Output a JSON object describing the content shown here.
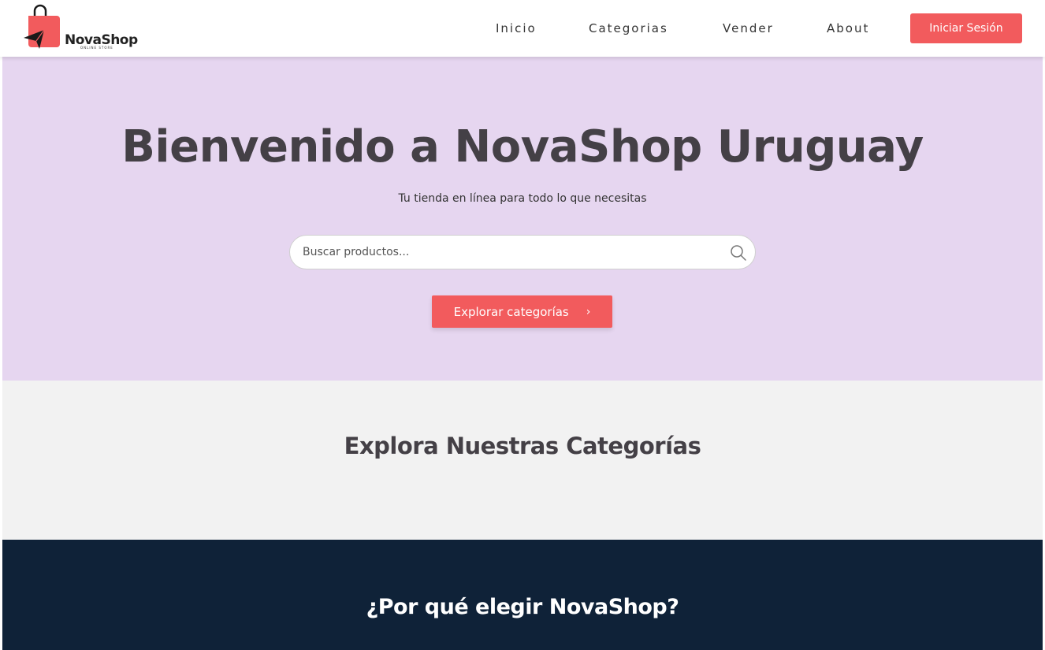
{
  "header": {
    "logo": {
      "name": "NovaShop",
      "tagline": "ONLINE STORE"
    },
    "nav": [
      {
        "label": "Inicio"
      },
      {
        "label": "Categorias"
      },
      {
        "label": "Vender"
      },
      {
        "label": "About"
      }
    ],
    "login_label": "Iniciar Sesión"
  },
  "hero": {
    "title": "Bienvenido a NovaShop Uruguay",
    "subtitle": "Tu tienda en línea para todo lo que necesitas",
    "search": {
      "placeholder": "Buscar productos...",
      "value": "",
      "icon": "search-icon"
    },
    "explore_label": "Explorar categorías",
    "explore_icon": "chevron-right-icon"
  },
  "categories": {
    "title": "Explora Nuestras Categorías"
  },
  "why": {
    "title": "¿Por qué elegir NovaShop?"
  },
  "colors": {
    "accent": "#f25b5d",
    "hero_bg": "#e6d6f0",
    "categories_bg": "#f2f2f2",
    "why_bg": "#0f2238",
    "heading_text": "#444046"
  }
}
